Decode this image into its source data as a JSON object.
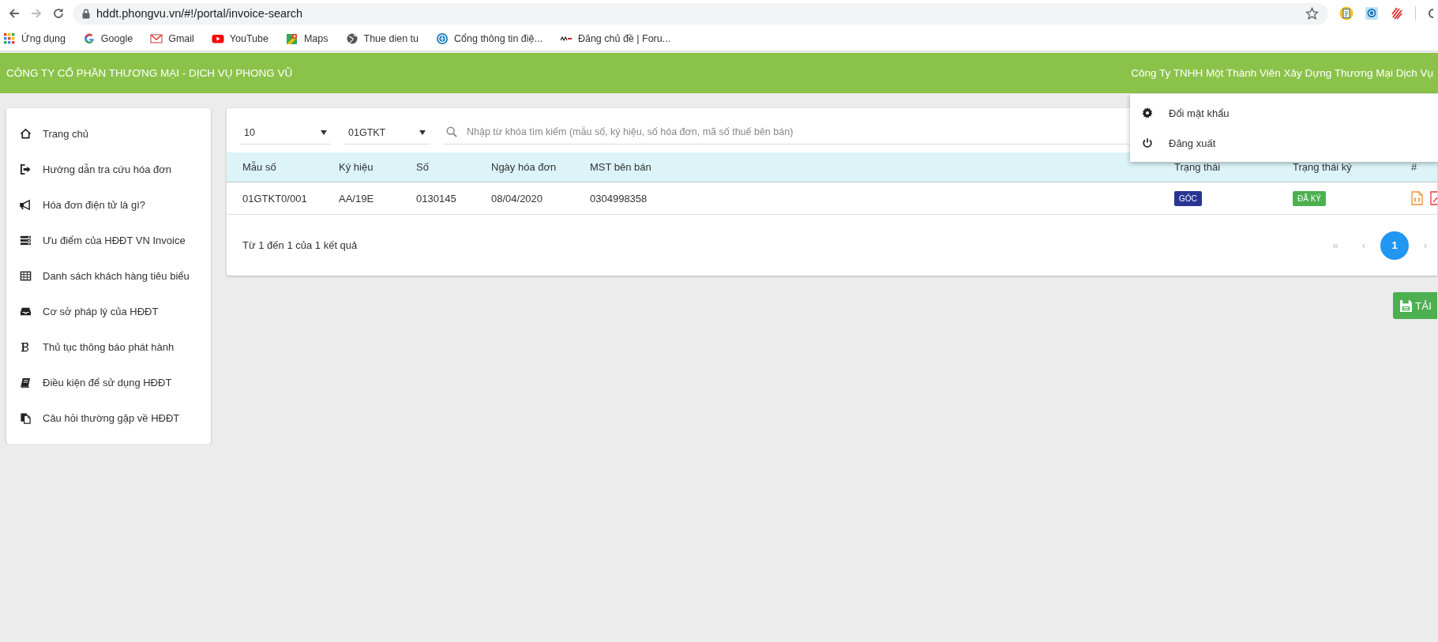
{
  "browser": {
    "url": "hddt.phongvu.vn/#!/portal/invoice-search",
    "nav_buttons": [
      {
        "kind": "back",
        "disabled": false
      },
      {
        "kind": "forward",
        "disabled": true
      },
      {
        "kind": "reload",
        "disabled": false
      }
    ],
    "bookmarks": [
      {
        "label": "Ứng dụng",
        "kind": "apps"
      },
      {
        "label": "Google",
        "kind": "google"
      },
      {
        "label": "Gmail",
        "kind": "gmail"
      },
      {
        "label": "YouTube",
        "kind": "youtube"
      },
      {
        "label": "Maps",
        "kind": "maps"
      },
      {
        "label": "Thue dien tu",
        "kind": "globe"
      },
      {
        "label": "Cổng thông tin điệ...",
        "kind": "portal"
      },
      {
        "label": "Đăng chủ đề | Foru...",
        "kind": "logo"
      }
    ]
  },
  "header": {
    "company": "CÔNG TY CỔ PHẦN THƯƠNG MẠI - DỊCH VỤ PHONG VŨ",
    "user": "Công Ty TNHH Một Thành Viên Xây Dựng Thương Mại Dịch Vụ"
  },
  "sidebar": {
    "items": [
      {
        "label": "Trang chủ",
        "kind": "home"
      },
      {
        "label": "Hướng dẫn tra cứu hóa đơn",
        "kind": "signin"
      },
      {
        "label": "Hóa đơn điện tử là gì?",
        "kind": "bullhorn"
      },
      {
        "label": "Ưu điểm của HĐĐT VN Invoice",
        "kind": "server"
      },
      {
        "label": "Danh sách khách hàng tiêu biểu",
        "kind": "table"
      },
      {
        "label": "Cơ sở pháp lý của HĐĐT",
        "kind": "inbox"
      },
      {
        "label": "Thủ tục thông báo phát hành",
        "kind": "bold"
      },
      {
        "label": "Điều kiện để sử dụng HĐĐT",
        "kind": "book"
      },
      {
        "label": "Câu hỏi thường gặp về HĐĐT",
        "kind": "copy"
      }
    ]
  },
  "filters": {
    "page_size": "10",
    "template": "01GTKT",
    "search": {
      "placeholder": "Nhập từ khóa tìm kiếm (mẫu số, ký hiệu, số hóa đơn, mã số thuế bên bán)"
    }
  },
  "table": {
    "columns": [
      "Mẫu số",
      "Ký hiệu",
      "Số",
      "Ngày hóa đơn",
      "MST bên bán",
      "Trạng thái",
      "Trạng thái ký",
      "#"
    ],
    "rows": [
      {
        "cells": [
          "01GTKT0/001",
          "AA/19E",
          "0130145",
          "08/04/2020",
          "0304998358"
        ],
        "status": {
          "label": "GÓC",
          "kind": "original"
        },
        "sign_status": {
          "label": "ĐÃ KÝ",
          "kind": "signed"
        },
        "actions": [
          {
            "kind": "xml"
          },
          {
            "kind": "pdf"
          }
        ]
      }
    ]
  },
  "summary": "Từ 1 đến 1 của 1 kết quả",
  "pagination": [
    {
      "label": "«",
      "kind": "first",
      "disabled": true,
      "selected": false
    },
    {
      "label": "‹",
      "kind": "prev",
      "disabled": true,
      "selected": false
    },
    {
      "label": "1",
      "kind": "page",
      "disabled": false,
      "selected": true
    },
    {
      "label": "›",
      "kind": "next",
      "disabled": true,
      "selected": false
    }
  ],
  "download_button": {
    "label": "TẢI"
  },
  "user_menu": {
    "items": [
      {
        "label": "Đổi mật khẩu",
        "kind": "gear"
      },
      {
        "label": "Đăng xuất",
        "kind": "power"
      }
    ]
  }
}
